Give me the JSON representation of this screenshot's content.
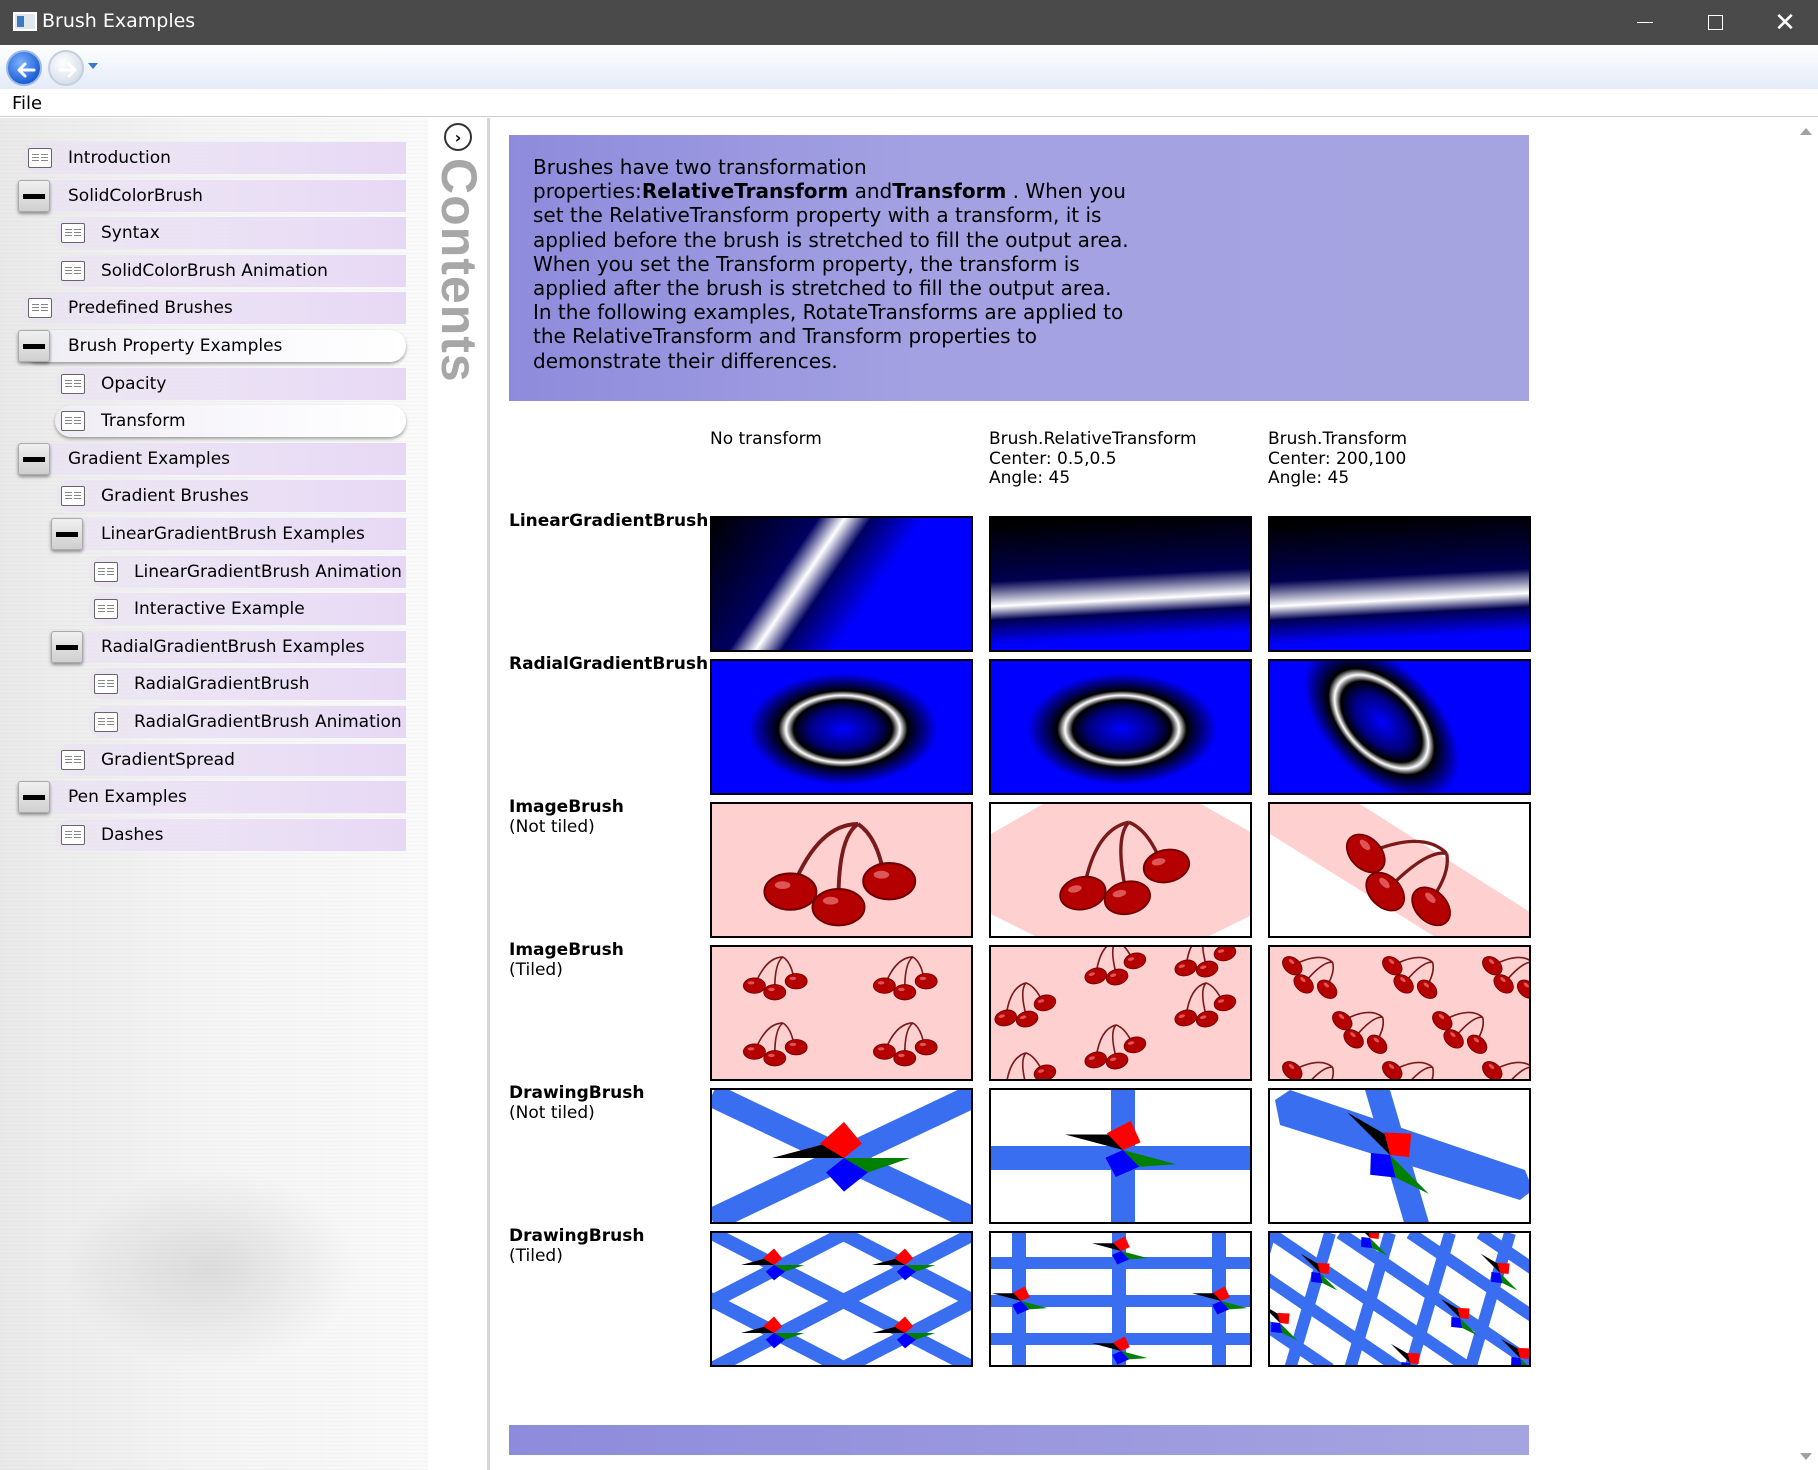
{
  "window": {
    "title": "Brush Examples"
  },
  "menu": {
    "file_label": "File"
  },
  "sidebar": {
    "items": [
      {
        "label": "Introduction",
        "icon": "book-icon"
      },
      {
        "label": "SolidColorBrush",
        "icon": "collapse-icon"
      },
      {
        "label": "Syntax",
        "icon": "book-icon"
      },
      {
        "label": "SolidColorBrush Animation",
        "icon": "book-icon"
      },
      {
        "label": "Predefined Brushes",
        "icon": "book-icon"
      },
      {
        "label": "Brush Property Examples",
        "icon": "collapse-icon",
        "selected": true
      },
      {
        "label": "Opacity",
        "icon": "book-icon"
      },
      {
        "label": "Transform",
        "icon": "book-icon",
        "selected": true
      },
      {
        "label": "Gradient Examples",
        "icon": "collapse-icon"
      },
      {
        "label": "Gradient Brushes",
        "icon": "book-icon"
      },
      {
        "label": "LinearGradientBrush Examples",
        "icon": "collapse-icon"
      },
      {
        "label": "LinearGradientBrush Animation",
        "icon": "book-icon"
      },
      {
        "label": "Interactive Example",
        "icon": "book-icon"
      },
      {
        "label": "RadialGradientBrush Examples",
        "icon": "collapse-icon"
      },
      {
        "label": "RadialGradientBrush",
        "icon": "book-icon"
      },
      {
        "label": "RadialGradientBrush Animation",
        "icon": "book-icon"
      },
      {
        "label": "GradientSpread",
        "icon": "book-icon"
      },
      {
        "label": "Pen Examples",
        "icon": "collapse-icon"
      },
      {
        "label": "Dashes",
        "icon": "book-icon"
      }
    ]
  },
  "splitter": {
    "label": "Contents",
    "toggle_glyph": "›"
  },
  "intro": {
    "part1": "Brushes have two transformation properties:",
    "bold1": "RelativeTransform",
    "part2": " and",
    "bold2": "Transform",
    "part3": " . When you set the RelativeTransform property with a transform, it is applied before the brush is stretched to fill the output area. When you set the Transform property, the transform is applied after the brush is stretched to fill the output area. In the following examples, RotateTransforms are applied to the RelativeTransform and Transform properties to demonstrate their differences."
  },
  "columns": [
    "No transform",
    "Brush.RelativeTransform\nCenter: 0.5,0.5\nAngle: 45",
    "Brush.Transform\nCenter: 200,100\nAngle: 45"
  ],
  "rows": [
    {
      "title": "LinearGradientBrush",
      "subtitle": ""
    },
    {
      "title": "RadialGradientBrush",
      "subtitle": ""
    },
    {
      "title": "ImageBrush",
      "subtitle": "(Not tiled)"
    },
    {
      "title": "ImageBrush",
      "subtitle": "(Tiled)"
    },
    {
      "title": "DrawingBrush",
      "subtitle": "(Not tiled)"
    },
    {
      "title": "DrawingBrush",
      "subtitle": "(Tiled)"
    }
  ],
  "colors": {
    "accent_band": "#9c9ae0",
    "brush_blue": "#0000ff",
    "pen_blue": "#3a6ef0",
    "cherry_bg": "#ffd0d0",
    "cherry_red": "#b00000"
  }
}
